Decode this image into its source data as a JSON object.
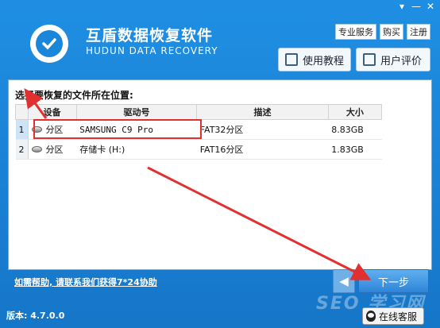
{
  "window": {
    "controls": [
      "▾",
      "—",
      "✕"
    ]
  },
  "brand": {
    "name_cn": "互盾数据恢复软件",
    "name_en": "HUDUN DATA RECOVERY"
  },
  "top_links": [
    "专业服务",
    "购买",
    "注册"
  ],
  "header_buttons": {
    "tutorial": "使用教程",
    "review": "用户评价"
  },
  "panel": {
    "title": "选择要恢复的文件所在位置:",
    "columns": [
      "设备",
      "驱动号",
      "描述",
      "大小"
    ],
    "rows": [
      {
        "num": "1",
        "device": "分区",
        "drive": "SAMSUNG C9 Pro",
        "desc": "FAT32分区",
        "size": "8.83GB"
      },
      {
        "num": "2",
        "device": "分区",
        "drive": "存储卡 (H:)",
        "desc": "FAT16分区",
        "size": "1.83GB"
      }
    ],
    "help_link": "如需帮助, 请联系我们获得7*24协助"
  },
  "nav": {
    "back_icon": "◀",
    "next": "下一步"
  },
  "footer": {
    "version": "版本: 4.7.0.0",
    "customer_service": "在线客服"
  },
  "watermark": "SEO 学习网",
  "colors": {
    "accent": "#1b7fd0",
    "highlight": "#e23030"
  },
  "icons": {
    "logo": "shield-check-icon",
    "tutorial": "book-icon",
    "review": "chat-icon",
    "cs": "qq-penguin-icon",
    "disk": "disk-icon"
  }
}
